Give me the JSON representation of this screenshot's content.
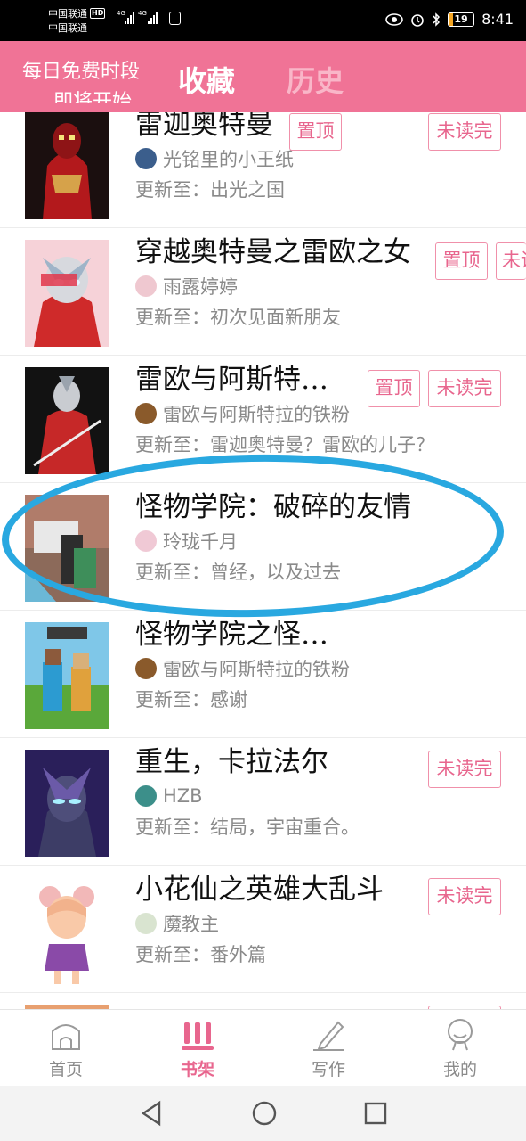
{
  "status_bar": {
    "carrier1": "中国联通",
    "carrier2": "中国联通",
    "hd": "HD",
    "net1": "4G",
    "net2": "4G",
    "battery": "19",
    "time": "8:41"
  },
  "header": {
    "promo_line1": "每日免费时段",
    "promo_line2": "即将开始",
    "tab_favorites": "收藏",
    "tab_history": "历史"
  },
  "books": [
    {
      "title": "雷迦奥特曼",
      "author": "光铭里的小王纸",
      "update": "更新至：出光之国",
      "badges": [
        "置顶",
        "未读完"
      ]
    },
    {
      "title": "穿越奥特曼之雷欧之女",
      "author": "雨露婷婷",
      "update": "更新至：初次见面新朋友",
      "badges": [
        "置顶",
        "未读完"
      ]
    },
    {
      "title": "雷欧与阿斯特…",
      "author": "雷欧与阿斯特拉的铁粉",
      "update": "更新至：雷迦奥特曼？雷欧的儿子？",
      "badges": [
        "置顶",
        "未读完"
      ]
    },
    {
      "title": "怪物学院：破碎的友情",
      "author": "玲珑千月",
      "update": "更新至：曾经，以及过去",
      "badges": []
    },
    {
      "title": "怪物学院之怪…",
      "author": "雷欧与阿斯特拉的铁粉",
      "update": "更新至：感谢",
      "badges": []
    },
    {
      "title": "重生，卡拉法尔",
      "author": "HZB",
      "update": "更新至：结局，宇宙重合。",
      "badges": [
        "未读完"
      ]
    },
    {
      "title": "小花仙之英雄大乱斗",
      "author": "魔教主",
      "update": "更新至：番外篇",
      "badges": [
        "未读完"
      ]
    }
  ],
  "bottom_nav": {
    "home": "首页",
    "bookshelf": "书架",
    "write": "写作",
    "mine": "我的"
  },
  "colors": {
    "accent": "#f07396",
    "badge_text": "#e8668e",
    "highlight_ring": "#29a8e0"
  }
}
